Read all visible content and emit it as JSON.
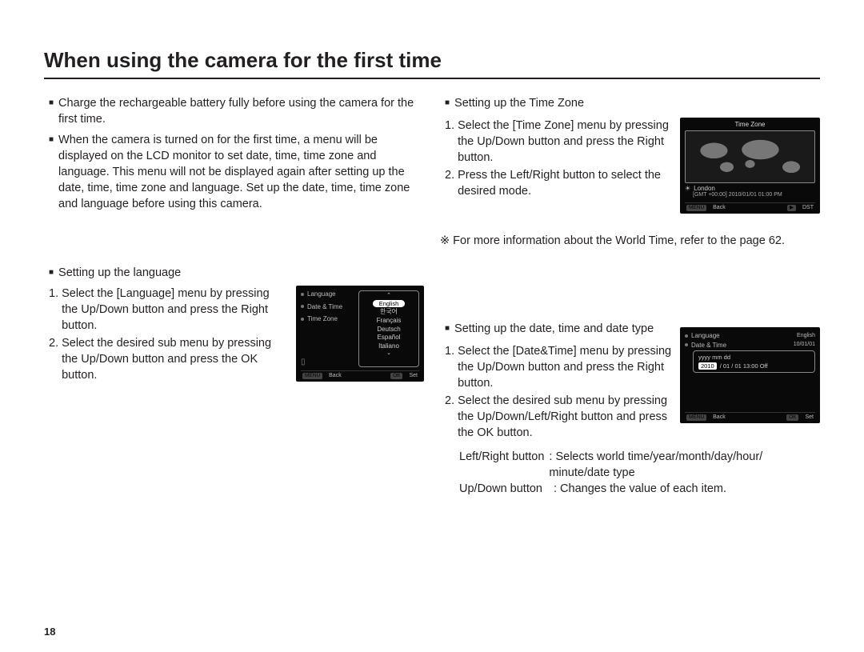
{
  "page_number": "18",
  "title": "When using the camera for the first time",
  "intro": {
    "b1": "Charge the rechargeable battery fully before using the camera for the first time.",
    "b2": "When the camera is turned on for the first time, a menu will be displayed on the LCD monitor to set date, time, time zone and language. This menu will not be displayed again after setting up the date, time, time zone and language. Set up the date, time, time zone and language before using this camera."
  },
  "lang": {
    "heading": "Setting up the language",
    "s1": "Select the [Language] menu by pressing the Up/Down button and press the Right button.",
    "s2": "Select the desired sub menu by pressing the Up/Down button and press the OK button.",
    "menu_items": {
      "language": "Language",
      "datetime": "Date & Time",
      "timezone": "Time Zone"
    },
    "options": {
      "sel": "English",
      "o1": "한국어",
      "o2": "Français",
      "o3": "Deutsch",
      "o4": "Español",
      "o5": "Italiano"
    },
    "foot": {
      "back_tag": "MENU",
      "back": "Back",
      "ok_tag": "OK",
      "set": "Set"
    }
  },
  "tz": {
    "heading": "Setting up the Time Zone",
    "s1": "Select the [Time Zone] menu by pressing the Up/Down button and press the Right button.",
    "s2": "Press the Left/Right button to select the desired mode.",
    "note": "※ For more information about the World Time, refer to the page 62.",
    "hdr": "Time Zone",
    "city": "London",
    "meta": "[GMT +00:00]    2010/01/01    01:00 PM",
    "foot": {
      "back_tag": "MENU",
      "back": "Back",
      "dst_tag": "▶",
      "dst": "DST"
    }
  },
  "dt": {
    "heading": "Setting up the date, time and date type",
    "s1": "Select the [Date&Time] menu by pressing the Up/Down button and press the Right button.",
    "s2": "Select the desired sub menu by pressing the Up/Down/Left/Right button and press the OK button.",
    "lr_label": "Left/Right button",
    "lr_value": ": Selects world time/year/month/day/hour/ minute/date type",
    "ud_label": "Up/Down button",
    "ud_value": ": Changes the value of each item.",
    "menu": {
      "language": "Language",
      "lang_val": "English",
      "datetime": "Date & Time",
      "dt_val": "10/01/01"
    },
    "fmt": "yyyy mm dd",
    "edit": {
      "yr": "2010",
      "rest": "/ 01 / 01   13:00   Off"
    },
    "foot": {
      "back_tag": "MENU",
      "back": "Back",
      "ok_tag": "OK",
      "set": "Set"
    }
  }
}
